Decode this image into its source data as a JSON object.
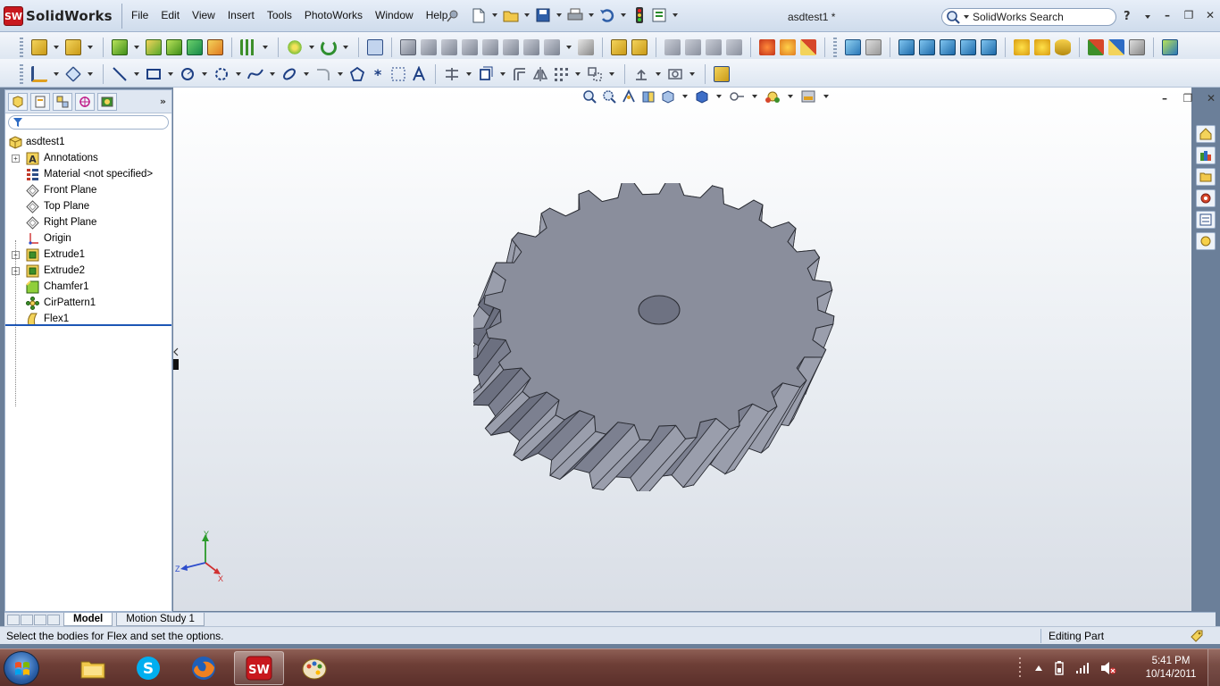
{
  "app": {
    "logo_text": "SolidWorks",
    "logo_badge": "SW",
    "document_title": "asdtest1 *"
  },
  "menu": [
    "File",
    "Edit",
    "View",
    "Insert",
    "Tools",
    "PhotoWorks",
    "Window",
    "Help"
  ],
  "search": {
    "label": "SolidWorks Search"
  },
  "help_label": "?",
  "window_controls": {
    "minimize": "–",
    "restore": "❐",
    "close": "✕"
  },
  "feature_tree": {
    "root": "asdtest1",
    "items": [
      {
        "label": "Annotations",
        "icon": "annotations-icon",
        "expandable": true
      },
      {
        "label": "Material <not specified>",
        "icon": "material-icon",
        "expandable": false
      },
      {
        "label": "Front Plane",
        "icon": "plane-icon",
        "expandable": false
      },
      {
        "label": "Top Plane",
        "icon": "plane-icon",
        "expandable": false
      },
      {
        "label": "Right Plane",
        "icon": "plane-icon",
        "expandable": false
      },
      {
        "label": "Origin",
        "icon": "origin-icon",
        "expandable": false
      },
      {
        "label": "Extrude1",
        "icon": "extrude-icon",
        "expandable": true
      },
      {
        "label": "Extrude2",
        "icon": "extrude-icon",
        "expandable": true
      },
      {
        "label": "Chamfer1",
        "icon": "chamfer-icon",
        "expandable": false
      },
      {
        "label": "CirPattern1",
        "icon": "circular-pattern-icon",
        "expandable": false
      },
      {
        "label": "Flex1",
        "icon": "flex-icon",
        "expandable": false
      }
    ],
    "expand_label": "»"
  },
  "triad": {
    "x": "X",
    "y": "Y",
    "z": "Z"
  },
  "bottom_tabs": [
    {
      "label": "Model",
      "active": true
    },
    {
      "label": "Motion Study 1",
      "active": false
    }
  ],
  "status": {
    "message": "Select the bodies for Flex and set the options.",
    "mode": "Editing Part"
  },
  "taskbar": {
    "apps": [
      "windows-explorer-icon",
      "skype-icon",
      "firefox-icon",
      "solidworks-icon",
      "paint-icon"
    ],
    "time": "5:41 PM",
    "date": "10/14/2011"
  },
  "colors": {
    "gear_face": "#8a8e9c",
    "gear_side": "#5e6272",
    "accent_blue": "#1c56b5",
    "sw_red": "#c8181e"
  }
}
